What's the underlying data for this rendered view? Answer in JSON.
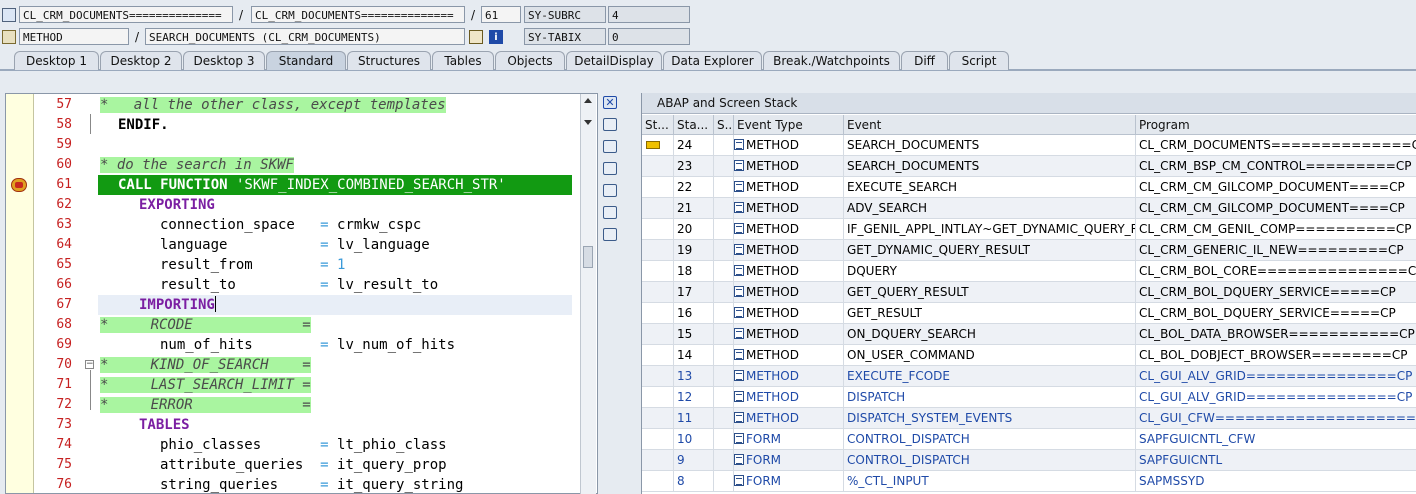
{
  "info": {
    "row1": {
      "program": "CL_CRM_DOCUMENTS==============",
      "include": "CL_CRM_DOCUMENTS==============",
      "line": "61",
      "sysvar": "SY-SUBRC",
      "sysval": "4"
    },
    "row2": {
      "type": "METHOD",
      "event": "SEARCH_DOCUMENTS (CL_CRM_DOCUMENTS)",
      "sysvar": "SY-TABIX",
      "sysval": "0"
    },
    "sep": "/"
  },
  "tabs": [
    "Desktop 1",
    "Desktop 2",
    "Desktop 3",
    "Standard",
    "Structures",
    "Tables",
    "Objects",
    "DetailDisplay",
    "Data Explorer",
    "Break./Watchpoints",
    "Diff",
    "Script"
  ],
  "editor": {
    "lines": [
      {
        "n": "57"
      },
      {
        "n": "58"
      },
      {
        "n": "59"
      },
      {
        "n": "60"
      },
      {
        "n": "61"
      },
      {
        "n": "62"
      },
      {
        "n": "63"
      },
      {
        "n": "64"
      },
      {
        "n": "65"
      },
      {
        "n": "66"
      },
      {
        "n": "67"
      },
      {
        "n": "68"
      },
      {
        "n": "69"
      },
      {
        "n": "70"
      },
      {
        "n": "71"
      },
      {
        "n": "72"
      },
      {
        "n": "73"
      },
      {
        "n": "74"
      },
      {
        "n": "75"
      },
      {
        "n": "76"
      }
    ],
    "code": {
      "l57": "*   all the other class, except templates",
      "l58": "ENDIF.",
      "l60": "* do the search in SKWF",
      "l61a": "CALL FUNCTION",
      "l61b": " 'SKWF_INDEX_COMBINED_SEARCH_STR'",
      "l62": "EXPORTING",
      "l63a": "connection_space   ",
      "l63b": "=",
      "l63c": " crmkw_cspc",
      "l64a": "language           ",
      "l64b": "=",
      "l64c": " lv_language",
      "l65a": "result_from        ",
      "l65b": "=",
      "l65c": "1",
      "l66a": "result_to          ",
      "l66b": "=",
      "l66c": " lv_result_to",
      "l67": "IMPORTING",
      "l68": "*     RCODE             =",
      "l69a": "num_of_hits        ",
      "l69b": "=",
      "l69c": " lv_num_of_hits",
      "l70": "*     KIND_OF_SEARCH    =",
      "l71": "*     LAST_SEARCH_LIMIT =",
      "l72": "*     ERROR             =",
      "l73": "TABLES",
      "l74a": "phio_classes       ",
      "l74b": "=",
      "l74c": " lt_phio_class",
      "l75a": "attribute_queries  ",
      "l75b": "=",
      "l75c": " it_query_prop",
      "l76a": "string_queries     ",
      "l76b": "=",
      "l76c": " it_query_string"
    }
  },
  "stack": {
    "title": "ABAP and Screen Stack",
    "headers": [
      "St...",
      "Sta...",
      "S...",
      "Event Type",
      "Event",
      "Program"
    ],
    "rows": [
      {
        "level": "24",
        "type": "METHOD",
        "event": "SEARCH_DOCUMENTS",
        "program": "CL_CRM_DOCUMENTS==============CP",
        "current": true
      },
      {
        "level": "23",
        "type": "METHOD",
        "event": "SEARCH_DOCUMENTS",
        "program": "CL_CRM_BSP_CM_CONTROL=========CP"
      },
      {
        "level": "22",
        "type": "METHOD",
        "event": "EXECUTE_SEARCH",
        "program": "CL_CRM_CM_GILCOMP_DOCUMENT====CP"
      },
      {
        "level": "21",
        "type": "METHOD",
        "event": "ADV_SEARCH",
        "program": "CL_CRM_CM_GILCOMP_DOCUMENT====CP"
      },
      {
        "level": "20",
        "type": "METHOD",
        "event": "IF_GENIL_APPL_INTLAY~GET_DYNAMIC_QUERY_R...",
        "program": "CL_CRM_CM_GENIL_COMP==========CP"
      },
      {
        "level": "19",
        "type": "METHOD",
        "event": "GET_DYNAMIC_QUERY_RESULT",
        "program": "CL_CRM_GENERIC_IL_NEW=========CP"
      },
      {
        "level": "18",
        "type": "METHOD",
        "event": "DQUERY",
        "program": "CL_CRM_BOL_CORE===============CP"
      },
      {
        "level": "17",
        "type": "METHOD",
        "event": "GET_QUERY_RESULT",
        "program": "CL_CRM_BOL_DQUERY_SERVICE=====CP"
      },
      {
        "level": "16",
        "type": "METHOD",
        "event": "GET_RESULT",
        "program": "CL_CRM_BOL_DQUERY_SERVICE=====CP"
      },
      {
        "level": "15",
        "type": "METHOD",
        "event": "ON_DQUERY_SEARCH",
        "program": "CL_BOL_DATA_BROWSER===========CP"
      },
      {
        "level": "14",
        "type": "METHOD",
        "event": "ON_USER_COMMAND",
        "program": "CL_BOL_DOBJECT_BROWSER========CP"
      },
      {
        "level": "13",
        "type": "METHOD",
        "event": "EXECUTE_FCODE",
        "program": "CL_GUI_ALV_GRID===============CP",
        "blue": true
      },
      {
        "level": "12",
        "type": "METHOD",
        "event": "DISPATCH",
        "program": "CL_GUI_ALV_GRID===============CP",
        "blue": true
      },
      {
        "level": "11",
        "type": "METHOD",
        "event": "DISPATCH_SYSTEM_EVENTS",
        "program": "CL_GUI_CFW====================CP",
        "blue": true
      },
      {
        "level": "10",
        "type": "FORM",
        "event": "CONTROL_DISPATCH",
        "program": "SAPFGUICNTL_CFW",
        "blue": true
      },
      {
        "level": "9",
        "type": "FORM",
        "event": "CONTROL_DISPATCH",
        "program": "SAPFGUICNTL",
        "blue": true
      },
      {
        "level": "8",
        "type": "FORM",
        "event": "%_CTL_INPUT",
        "program": "SAPMSSYD",
        "blue": true
      }
    ]
  }
}
